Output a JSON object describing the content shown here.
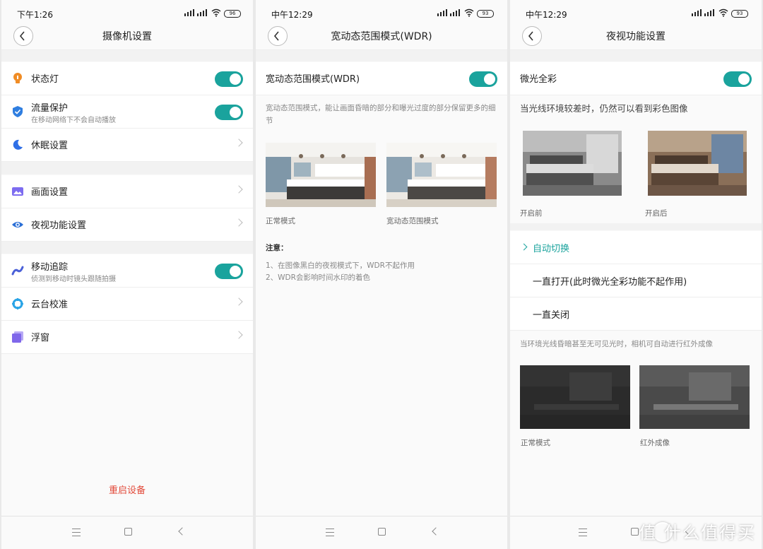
{
  "colors": {
    "accent": "#1aa39d",
    "danger": "#e24a3a",
    "lamp": "#f08c25",
    "shield": "#2f7ee0",
    "moon": "#2f6fe6",
    "picture": "#7d6cf0",
    "eye": "#2b6fd6",
    "track": "#4a60d8",
    "ptz": "#2aa4e6",
    "window": "#7f67ea"
  },
  "screen1": {
    "status": {
      "time": "下午1:26",
      "battery": "96"
    },
    "title": "摄像机设置",
    "items": [
      {
        "label": "状态灯",
        "icon": "lightbulb-icon",
        "control": "toggle"
      },
      {
        "label": "流量保护",
        "sub": "在移动网络下不会自动播放",
        "icon": "shield-icon",
        "control": "toggle"
      },
      {
        "label": "休眠设置",
        "icon": "moon-icon",
        "control": "chevron"
      },
      {
        "label": "画面设置",
        "icon": "picture-icon",
        "control": "chevron"
      },
      {
        "label": "夜视功能设置",
        "icon": "eye-icon",
        "control": "chevron"
      },
      {
        "label": "移动追踪",
        "sub": "侦测到移动时镜头跟随拍摄",
        "icon": "tracking-icon",
        "control": "toggle"
      },
      {
        "label": "云台校准",
        "icon": "ptz-icon",
        "control": "chevron"
      },
      {
        "label": "浮窗",
        "icon": "float-window-icon",
        "control": "chevron"
      }
    ],
    "restart": "重启设备"
  },
  "screen2": {
    "status": {
      "time": "中午12:29",
      "battery": "93"
    },
    "title": "宽动态范围模式(WDR)",
    "toggle_label": "宽动态范围模式(WDR)",
    "desc": "宽动态范围模式，能让画面昏暗的部分和曝光过度的部分保留更多的细节",
    "captions": [
      "正常模式",
      "宽动态范围模式"
    ],
    "notes_title": "注意：",
    "notes": [
      "1、在图像黑白的夜视模式下，WDR不起作用",
      "2、WDR会影响时间水印的着色"
    ]
  },
  "screen3": {
    "status": {
      "time": "中午12:29",
      "battery": "93"
    },
    "title": "夜视功能设置",
    "toggle_label": "微光全彩",
    "desc": "当光线环境较差时，仍然可以看到彩色图像",
    "captions_top": [
      "开启前",
      "开启后"
    ],
    "options": [
      "自动切换",
      "一直打开(此时微光全彩功能不起作用)",
      "一直关闭"
    ],
    "selected_option": "自动切换",
    "ir_desc": "当环境光线昏暗甚至无可见光时，相机可自动进行红外成像",
    "captions_bottom": [
      "正常模式",
      "红外成像"
    ]
  },
  "watermark": "值 什么值得买"
}
